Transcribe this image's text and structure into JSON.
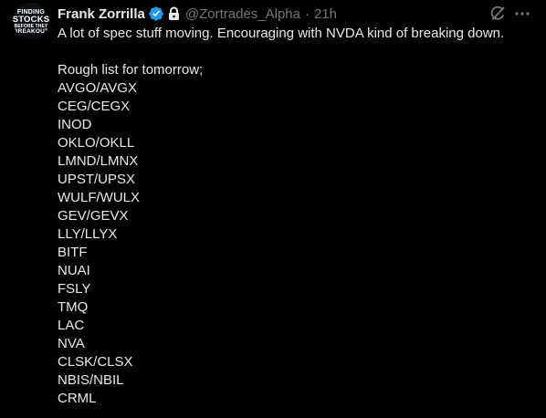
{
  "author": {
    "display_name": "Frank Zorrilla",
    "handle": "@Zortrades_Alpha",
    "separator": "·",
    "timestamp": "21h",
    "avatar_text": [
      "FINDING",
      "STOCKS",
      "BEFORE THEY",
      "BREAKOUT"
    ]
  },
  "tweet": {
    "line1": "A lot of spec stuff moving. Encouraging with NVDA kind of breaking down.",
    "list_intro": "Rough list for tomorrow;",
    "tickers": [
      "AVGO/AVGX",
      "CEG/CEGX",
      "INOD",
      "OKLO/OKLL",
      "LMND/LMNX",
      "UPST/UPSX",
      "WULF/WULX",
      "GEV/GEVX",
      "LLY/LLYX",
      "BITF",
      "NUAI",
      "FSLY",
      "TMQ",
      "LAC",
      "NVA",
      "CLSK/CLSX",
      "NBIS/NBIL",
      "CRML"
    ]
  },
  "icons": {
    "verified": "verified-badge-icon",
    "lock": "lock-icon",
    "grok": "grok-icon",
    "more": "more-icon"
  },
  "colors": {
    "background": "#000000",
    "primary_text": "#e7e9ea",
    "secondary_text": "#71767b",
    "verified_blue": "#1d9bf0"
  }
}
